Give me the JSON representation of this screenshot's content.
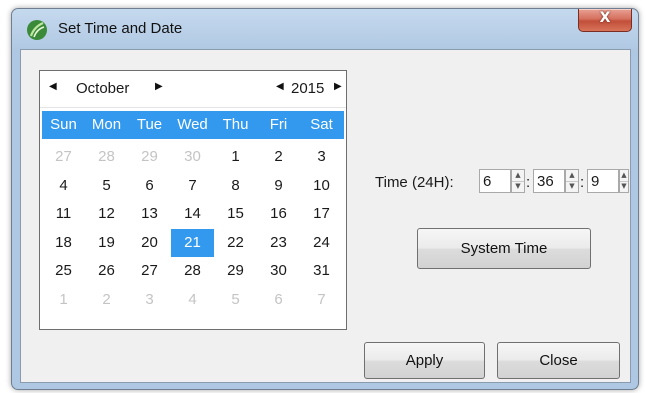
{
  "window": {
    "title": "Set Time and Date",
    "close_glyph": "X"
  },
  "calendar": {
    "month": "October",
    "year": "2015",
    "prev_glyph": "◀",
    "next_glyph": "▶",
    "weekdays": [
      "Sun",
      "Mon",
      "Tue",
      "Wed",
      "Thu",
      "Fri",
      "Sat"
    ],
    "weeks": [
      [
        "27",
        "28",
        "29",
        "30",
        "1",
        "2",
        "3"
      ],
      [
        "4",
        "5",
        "6",
        "7",
        "8",
        "9",
        "10"
      ],
      [
        "11",
        "12",
        "13",
        "14",
        "15",
        "16",
        "17"
      ],
      [
        "18",
        "19",
        "20",
        "21",
        "22",
        "23",
        "24"
      ],
      [
        "25",
        "26",
        "27",
        "28",
        "29",
        "30",
        "31"
      ],
      [
        "1",
        "2",
        "3",
        "4",
        "5",
        "6",
        "7"
      ]
    ],
    "selected_day": "21",
    "colors": {
      "header_bg": "#3399ee",
      "selected_bg": "#3399ee",
      "other_month": "#c4c4c4"
    }
  },
  "time": {
    "label": "Time (24H):",
    "hour": "6",
    "minute": "36",
    "second": "9",
    "separator": ":"
  },
  "buttons": {
    "system_time": "System Time",
    "apply": "Apply",
    "close": "Close"
  }
}
